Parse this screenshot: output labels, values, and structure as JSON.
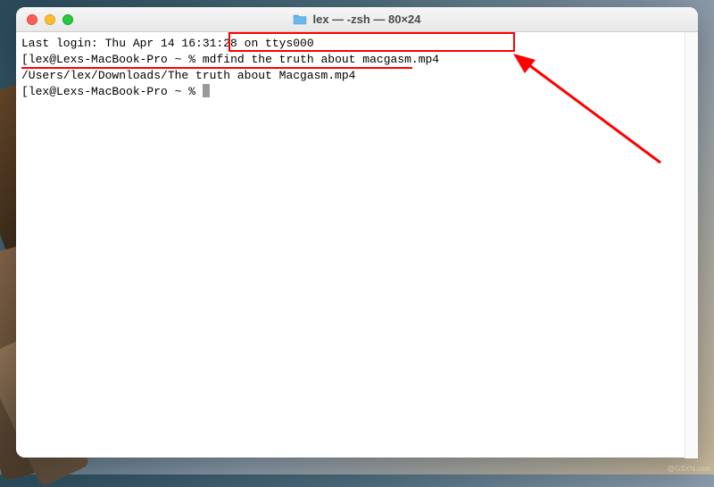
{
  "window": {
    "title": "lex — -zsh — 80×24"
  },
  "terminal": {
    "line1": "Last login: Thu Apr 14 16:31:28 on ttys000",
    "prompt_prefix1": "[",
    "prompt1": "lex@Lexs-MacBook-Pro ~ % ",
    "command1": "mdfind the truth about macgasm.mp4",
    "prompt_suffix1": "]",
    "output1": "/Users/lex/Downloads/The truth about Macgasm.mp4",
    "prompt_prefix2": "[",
    "prompt2": "lex@Lexs-MacBook-Pro ~ % ",
    "prompt_suffix2": "]"
  },
  "watermark": "@GSXN.com"
}
